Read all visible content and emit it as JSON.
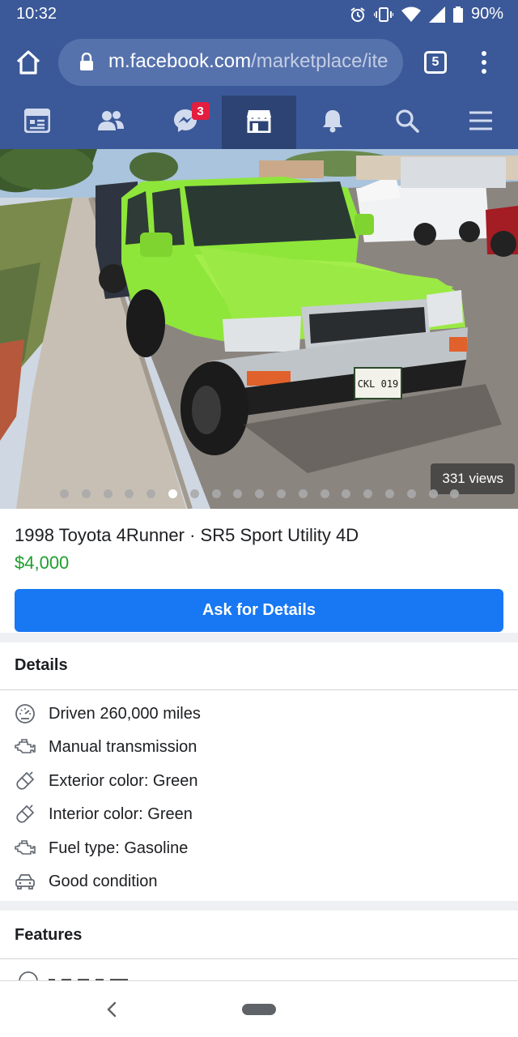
{
  "status_bar": {
    "time": "10:32",
    "battery": "90%",
    "icons": [
      "alarm-icon",
      "vibrate-icon",
      "wifi-icon",
      "signal-icon",
      "battery-icon"
    ]
  },
  "browser": {
    "url_domain": "m.facebook.com",
    "url_path": "/marketplace/ite",
    "tab_count": "5"
  },
  "fb_nav": {
    "items": [
      {
        "name": "news-feed-icon",
        "active": false
      },
      {
        "name": "friends-icon",
        "active": false
      },
      {
        "name": "messenger-icon",
        "active": false,
        "badge": "3"
      },
      {
        "name": "marketplace-icon",
        "active": true
      },
      {
        "name": "notifications-icon",
        "active": false
      },
      {
        "name": "search-icon",
        "active": false
      },
      {
        "name": "menu-icon",
        "active": false
      }
    ]
  },
  "photo": {
    "views": "331 views",
    "dot_count": 19,
    "active_dot": 5
  },
  "listing": {
    "title": "1998 Toyota 4Runner · SR5 Sport Utility 4D",
    "price": "$4,000",
    "ask_button": "Ask for Details"
  },
  "details": {
    "heading": "Details",
    "items": [
      {
        "icon": "speedometer-icon",
        "text": "Driven 260,000 miles"
      },
      {
        "icon": "engine-icon",
        "text": "Manual transmission"
      },
      {
        "icon": "paintbrush-icon",
        "text": "Exterior color: Green"
      },
      {
        "icon": "paintbrush-icon",
        "text": "Interior color: Green"
      },
      {
        "icon": "engine-icon",
        "text": "Fuel type: Gasoline"
      },
      {
        "icon": "car-icon",
        "text": "Good condition"
      }
    ]
  },
  "features": {
    "heading": "Features"
  },
  "colors": {
    "facebook_blue": "#3b5998",
    "active_nav": "#2d4373",
    "button_blue": "#1877f2",
    "price_green": "#1d9e2c",
    "badge_red": "#e41e3f",
    "vehicle_green": "#8ee63a"
  }
}
